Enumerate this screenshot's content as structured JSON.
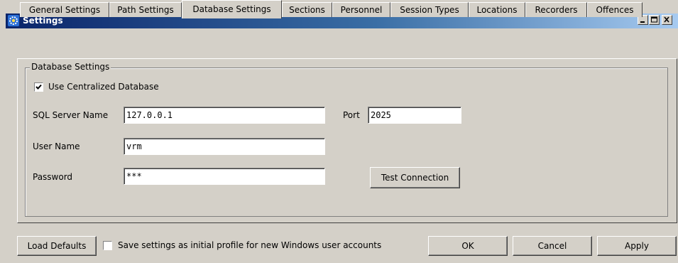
{
  "window": {
    "title": "Settings",
    "icon": "gear-icon",
    "caption_buttons": [
      "minimize-icon",
      "maximize-icon",
      "close-icon"
    ]
  },
  "tabs": [
    {
      "label": "General Settings",
      "active": false
    },
    {
      "label": "Path Settings",
      "active": false
    },
    {
      "label": "Database Settings",
      "active": true
    },
    {
      "label": "Sections",
      "active": false
    },
    {
      "label": "Personnel",
      "active": false
    },
    {
      "label": "Session Types",
      "active": false
    },
    {
      "label": "Locations",
      "active": false
    },
    {
      "label": "Recorders",
      "active": false
    },
    {
      "label": "Offences",
      "active": false
    }
  ],
  "database": {
    "group_title": "Database Settings",
    "use_centralized": {
      "label": "Use Centralized Database",
      "checked": true
    },
    "sql_server_label": "SQL Server Name",
    "sql_server_value": "127.0.0.1",
    "port_label": "Port",
    "port_value": "2025",
    "username_label": "User Name",
    "username_value": "vrm",
    "password_label": "Password",
    "password_value": "***",
    "test_connection_label": "Test Connection"
  },
  "footer": {
    "load_defaults_label": "Load Defaults",
    "save_profile": {
      "label": "Save settings as initial profile for new Windows user accounts",
      "checked": false
    },
    "ok_label": "OK",
    "cancel_label": "Cancel",
    "apply_label": "Apply"
  }
}
